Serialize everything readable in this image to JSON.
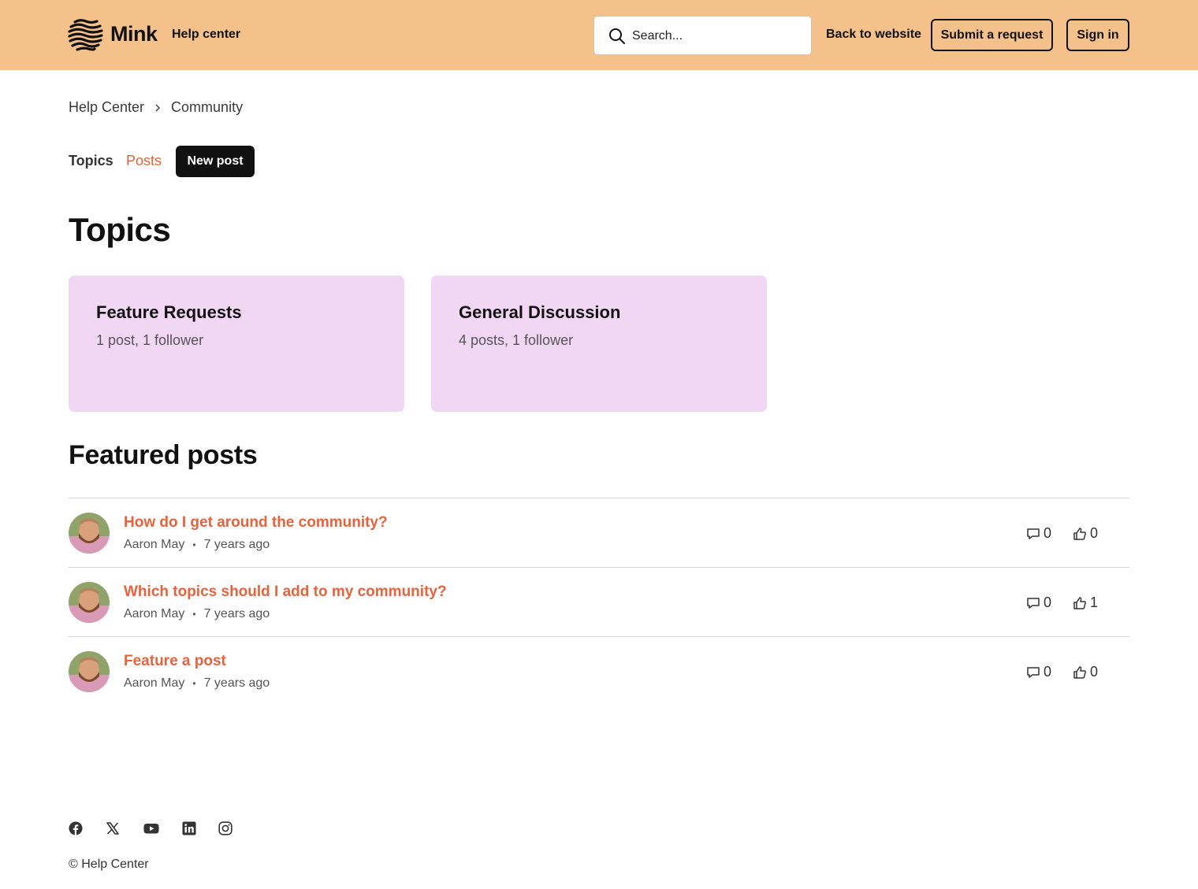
{
  "header": {
    "brand": "Mink",
    "help_center": "Help center",
    "search_placeholder": "Search...",
    "back_to_website": "Back to website",
    "submit_request": "Submit a request",
    "sign_in": "Sign in",
    "background_color": "#f4c18a"
  },
  "breadcrumb": [
    "Help Center",
    "Community"
  ],
  "tabs": {
    "topics": "Topics",
    "posts": "Posts",
    "new_post": "New post"
  },
  "page_title": "Topics",
  "topics": [
    {
      "title": "Feature Requests",
      "meta": "1 post, 1 follower"
    },
    {
      "title": "General Discussion",
      "meta": "4 posts, 1 follower"
    }
  ],
  "featured_title": "Featured posts",
  "posts": [
    {
      "title": "How do I get around the community?",
      "author": "Aaron May",
      "dot": "•",
      "time": "7 years ago",
      "comments": "0",
      "votes": "0"
    },
    {
      "title": "Which topics should I add to my community?",
      "author": "Aaron May",
      "dot": "•",
      "time": "7 years ago",
      "comments": "0",
      "votes": "1"
    },
    {
      "title": "Feature a post",
      "author": "Aaron May",
      "dot": "•",
      "time": "7 years ago",
      "comments": "0",
      "votes": "0"
    }
  ],
  "footer": {
    "social_icons": [
      "facebook-icon",
      "x-icon",
      "youtube-icon",
      "linkedin-icon",
      "instagram-icon"
    ],
    "copyright": "© Help Center"
  },
  "colors": {
    "accent": "#e8623c",
    "card": "#f2d7f5",
    "dark": "#111111"
  }
}
